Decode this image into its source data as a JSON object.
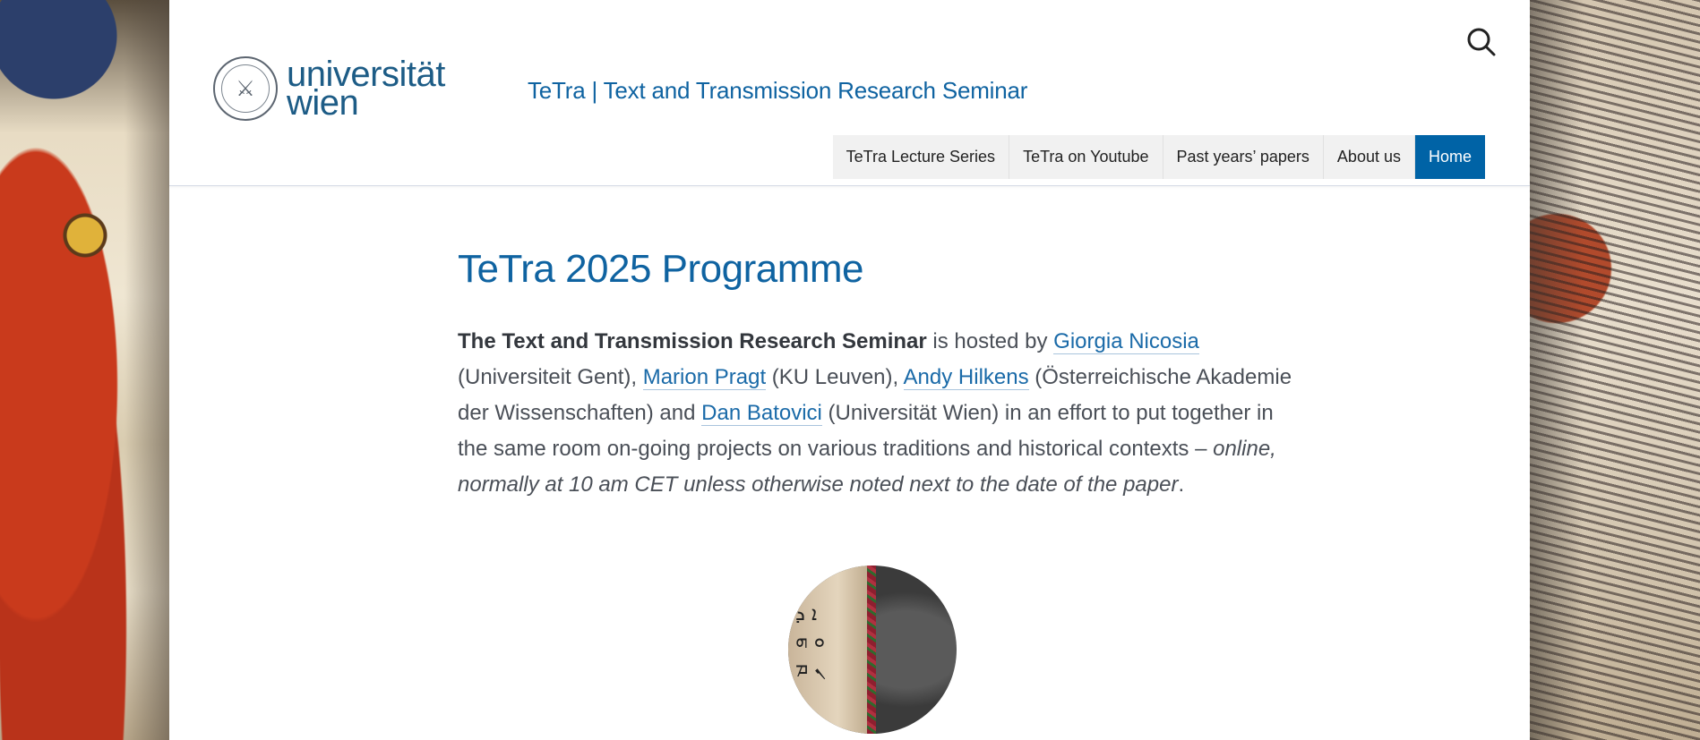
{
  "header": {
    "logo": {
      "line1": "universität",
      "line2": "wien"
    },
    "site_title": "TeTra | Text and Transmission Research Seminar",
    "search_icon": "search-icon"
  },
  "nav": {
    "items": [
      {
        "label": "TeTra Lecture Series"
      },
      {
        "label": "TeTra on Youtube"
      },
      {
        "label": "Past years’ papers"
      },
      {
        "label": "About us"
      },
      {
        "label": "Home",
        "active": true
      }
    ],
    "active_color": "#0063a6"
  },
  "main": {
    "title": "TeTra 2025 Programme",
    "intro": {
      "bold": "The Text and Transmission Research Seminar",
      "t1": " is hosted by ",
      "link1": "Giorgia Nicosia",
      "t2": " (Universiteit Gent), ",
      "link2": "Marion Pragt",
      "t3": " (KU Leuven), ",
      "link3": "Andy Hilkens",
      "t4": " (Österreichische Akademie der Wissenschaften) and ",
      "link4": "Dan Batovici",
      "t5": " (Universität Wien) in an effort to put together in the same room on-going projects on various traditions and historical contexts – ",
      "italic": "online, normally at 10 am CET unless otherwise noted next to the date of the paper",
      "t6": "."
    }
  },
  "colors": {
    "brand": "#0f63a1",
    "text": "#4a4f57"
  }
}
